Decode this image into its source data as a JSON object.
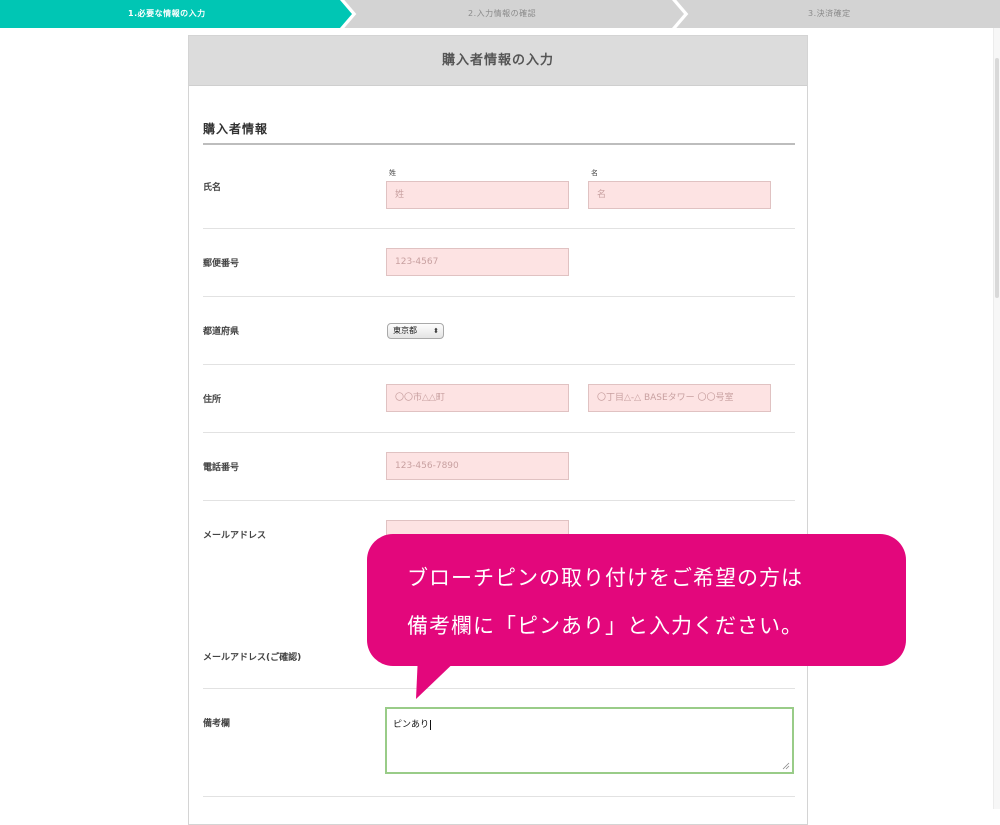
{
  "steps": [
    {
      "label": "1.必要な情報の入力",
      "active": true
    },
    {
      "label": "2.入力情報の確認",
      "active": false
    },
    {
      "label": "3.決済確定",
      "active": false
    }
  ],
  "colors": {
    "step_active": "#00c6b4",
    "step_inactive": "#d3d3d3",
    "callout": "#e3077c",
    "field_bg": "#fde3e3",
    "textarea_border": "#99cc88"
  },
  "form": {
    "header": "購入者情報の入力",
    "section_title": "購入者情報",
    "name": {
      "label": "氏名",
      "last_label": "姓",
      "first_label": "名",
      "last_placeholder": "姓",
      "first_placeholder": "名"
    },
    "postal": {
      "label": "郵便番号",
      "placeholder": "123-4567"
    },
    "prefecture": {
      "label": "都道府県",
      "selected": "東京都",
      "icon": "select-arrows-icon"
    },
    "address": {
      "label": "住所",
      "placeholder1": "〇〇市△△町",
      "placeholder2": "〇丁目△-△ BASEタワー 〇〇号室"
    },
    "phone": {
      "label": "電話番号",
      "placeholder": "123-456-7890"
    },
    "email": {
      "label": "メールアドレス"
    },
    "email_confirm": {
      "label": "メールアドレス(ご確認)"
    },
    "notes": {
      "label": "備考欄",
      "value": "ピンあり"
    }
  },
  "callout": {
    "line1": "ブローチピンの取り付けをご希望の方は",
    "line2": "備考欄に「ピンあり」と入力ください。"
  }
}
